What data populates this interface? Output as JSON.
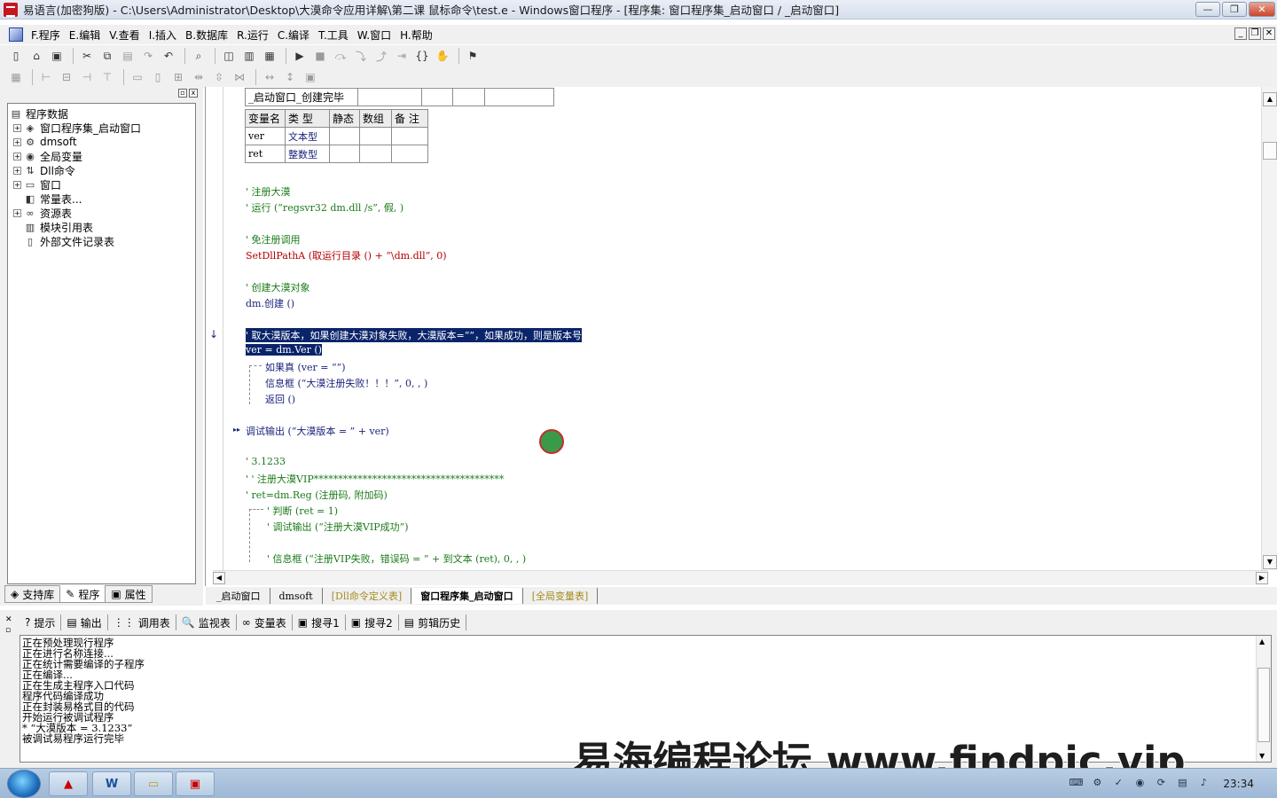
{
  "titlebar": {
    "title": "易语言(加密狗版) - C:\\Users\\Administrator\\Desktop\\大漠命令应用详解\\第二课 鼠标命令\\test.e - Windows窗口程序 - [程序集: 窗口程序集_启动窗口 / _启动窗口]",
    "min_icon": "—",
    "max_icon": "❐",
    "close_icon": "✕"
  },
  "menu": [
    "F.程序",
    "E.编辑",
    "V.查看",
    "I.插入",
    "B.数据库",
    "R.运行",
    "C.编译",
    "T.工具",
    "W.窗口",
    "H.帮助"
  ],
  "mdi_controls": [
    "_",
    "❐",
    "✕"
  ],
  "left_panel": {
    "tree": [
      {
        "label": "程序数据",
        "icon": "program-data-icon",
        "glyph": "▤",
        "expander": ""
      },
      {
        "label": "窗口程序集_启动窗口",
        "icon": "module-icon",
        "glyph": "◈",
        "expander": "+"
      },
      {
        "label": "dmsoft",
        "icon": "class-icon",
        "glyph": "⚙",
        "expander": "+"
      },
      {
        "label": "全局变量",
        "icon": "global-var-icon",
        "glyph": "◉",
        "expander": "+"
      },
      {
        "label": "Dll命令",
        "icon": "dll-icon",
        "glyph": "⇅",
        "expander": "+"
      },
      {
        "label": "窗口",
        "icon": "window-icon",
        "glyph": "▭",
        "expander": "+"
      },
      {
        "label": "常量表...",
        "icon": "constant-icon",
        "glyph": "◧",
        "expander": ""
      },
      {
        "label": "资源表",
        "icon": "resource-icon",
        "glyph": "∞",
        "expander": "+"
      },
      {
        "label": "模块引用表",
        "icon": "module-ref-icon",
        "glyph": "▥",
        "expander": ""
      },
      {
        "label": "外部文件记录表",
        "icon": "file-record-icon",
        "glyph": "▯",
        "expander": ""
      }
    ],
    "tabs": [
      "支持库",
      "程序",
      "属性"
    ]
  },
  "editor": {
    "sub_name": "_启动窗口_创建完毕",
    "var_table": {
      "headers": [
        "变量名",
        "类 型",
        "静态",
        "数组",
        "备 注"
      ],
      "rows": [
        [
          "ver",
          "文本型",
          "",
          "",
          ""
        ],
        [
          "ret",
          "整数型",
          "",
          "",
          ""
        ]
      ]
    },
    "lines": {
      "c1": "' 注册大漠",
      "c2": "' 运行 (“regsvr32 dm.dll /s”, 假, )",
      "c3": "' 免注册调用",
      "l4": "SetDllPathA (取运行目录 () + “\\dm.dll”, 0)",
      "c5": "' 创建大漠对象",
      "l6": "dm.创建 ()",
      "c7": "' 取大漠版本，如果创建大漠对象失败，大漠版本=“”，如果成功，则是版本号",
      "l8": "ver = dm.Ver ()",
      "l9": "如果真 (ver = “”)",
      "l10": "信息框 (“大漠注册失败！！！”, 0, , )",
      "l11": "返回 ()",
      "l12": "调试输出 (“大漠版本 = ” + ver)",
      "c13": "' 3.1233",
      "c14": "' ' 注册大漠VIP***************************************",
      "c15": "' ret=dm.Reg (注册码, 附加码)",
      "c16": "' 判断 (ret = 1)",
      "c17": "' 调试输出 (“注册大漠VIP成功”)",
      "c18": "' 信息框 (“注册VIP失败，错误码 = ” + 到文本 (ret), 0, , )"
    },
    "gutter_marks": {
      "breakpoint": "↓",
      "current": "▸▸"
    }
  },
  "editor_tabs": [
    {
      "label": "_启动窗口",
      "style": "normal"
    },
    {
      "label": "dmsoft",
      "style": "normal"
    },
    {
      "label": "[Dll命令定义表]",
      "style": "gold"
    },
    {
      "label": "窗口程序集_启动窗口",
      "style": "active"
    },
    {
      "label": "[全局变量表]",
      "style": "gold"
    }
  ],
  "bottom_tabs": [
    {
      "label": "提示",
      "glyph": "?"
    },
    {
      "label": "输出",
      "glyph": "▤"
    },
    {
      "label": "调用表",
      "glyph": "⋮⋮"
    },
    {
      "label": "监视表",
      "glyph": "🔍"
    },
    {
      "label": "变量表",
      "glyph": "∞"
    },
    {
      "label": "搜寻1",
      "glyph": "▣"
    },
    {
      "label": "搜寻2",
      "glyph": "▣"
    },
    {
      "label": "剪辑历史",
      "glyph": "▤"
    }
  ],
  "output_lines": "正在预处理现行程序\n正在进行名称连接...\n正在统计需要编译的子程序\n正在编译...\n正在生成主程序入口代码\n程序代码编译成功\n正在封装易格式目的代码\n开始运行被调试程序\n* “大漠版本 = 3.1233”\n被调试易程序运行完毕",
  "watermark": "易海编程论坛 www.findpic.vip",
  "taskbar": {
    "clock": "23:34",
    "items": [
      "acrobat-icon",
      "word-icon",
      "explorer-icon",
      "eyuyan-icon"
    ]
  }
}
